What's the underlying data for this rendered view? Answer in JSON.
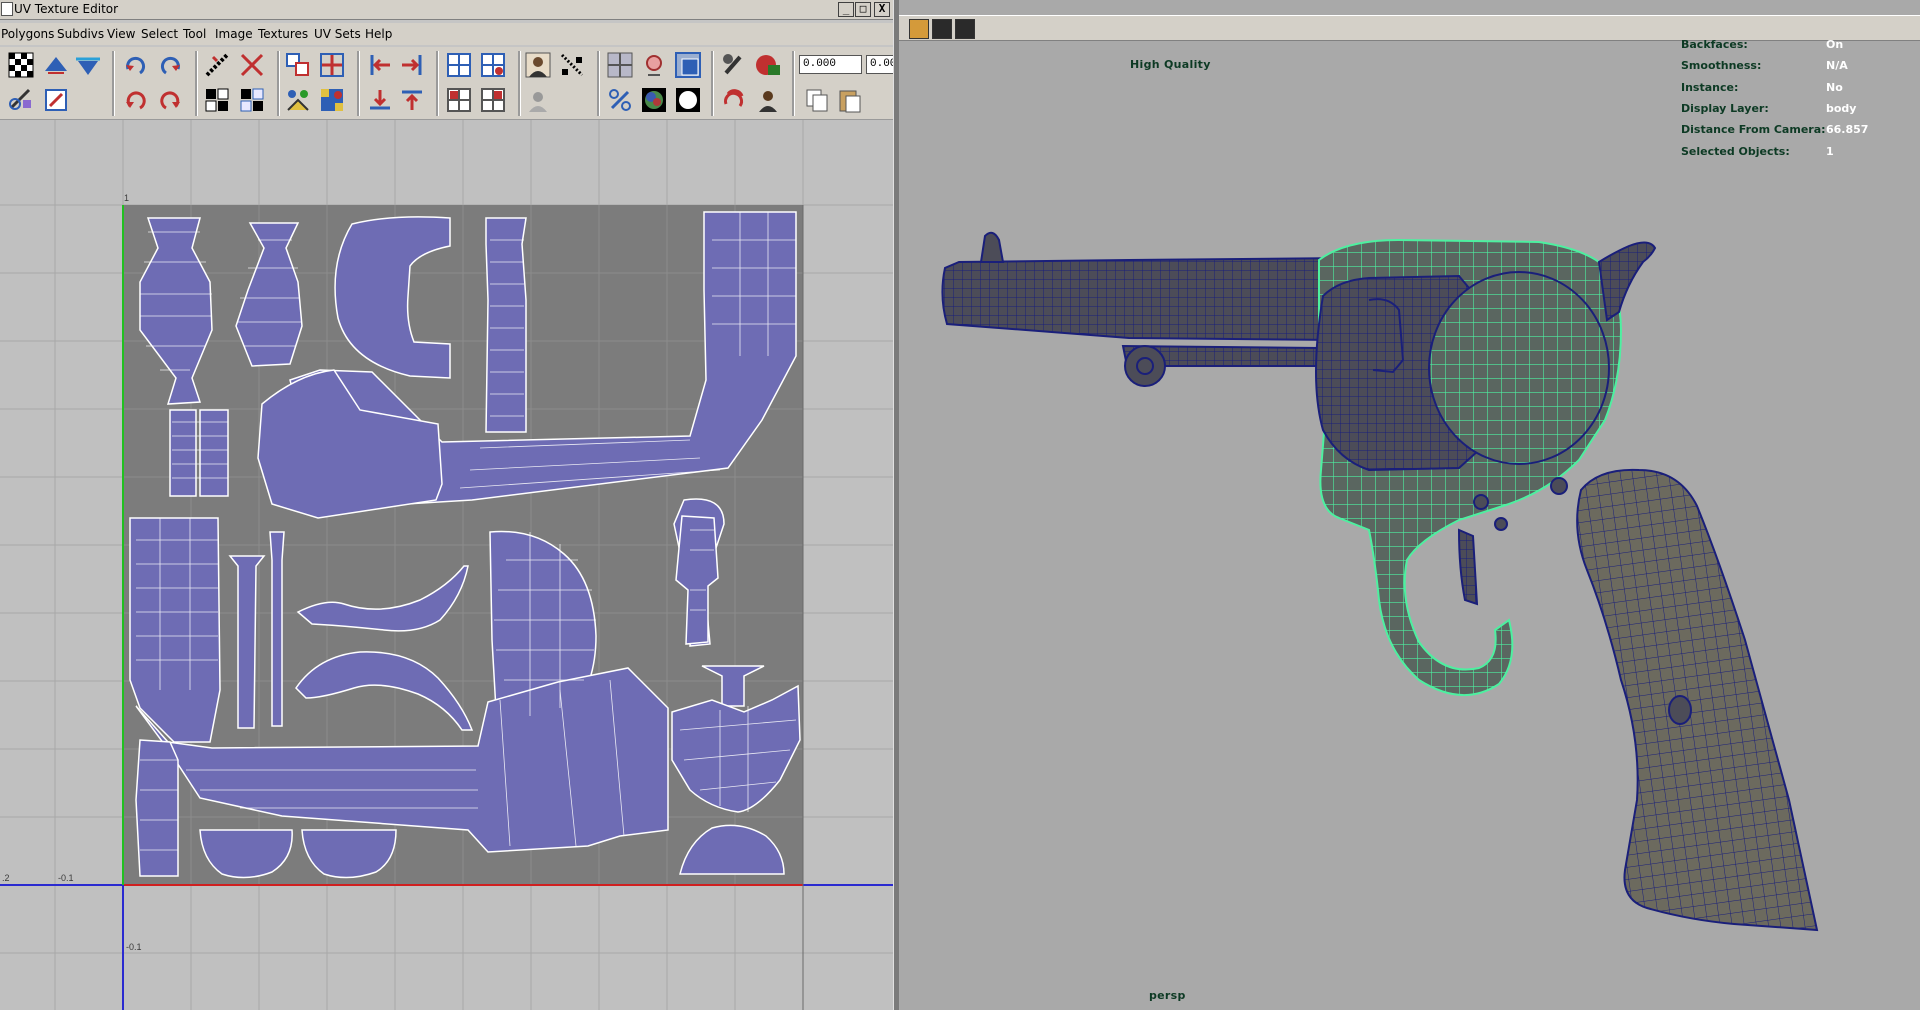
{
  "uv_editor": {
    "title": "UV Texture Editor",
    "window_buttons": {
      "minimize": "_",
      "maximize": "□",
      "close": "X"
    },
    "menus": [
      "Polygons",
      "Subdivs",
      "View",
      "Select",
      "Tool",
      "Image",
      "Textures",
      "UV Sets",
      "Help"
    ],
    "fields": {
      "u_value": "0.000",
      "v_value": "0.00"
    },
    "axis_labels": {
      "top_tick": "1",
      "left_neg_02": ".2",
      "left_neg_01": "-0.1",
      "below_neg_01": "-0.1"
    }
  },
  "viewport": {
    "quality_label": "High Quality",
    "camera_label": "persp",
    "hud": [
      {
        "label": "Backfaces:",
        "value": "On"
      },
      {
        "label": "Smoothness:",
        "value": "N/A"
      },
      {
        "label": "Instance:",
        "value": "No"
      },
      {
        "label": "Display Layer:",
        "value": "body"
      },
      {
        "label": "Distance From Camera:",
        "value": "66.857"
      },
      {
        "label": "Selected Objects:",
        "value": "1"
      }
    ]
  },
  "colors": {
    "uv_shell_fill": "#6e6cb4",
    "uv_line": "#ffffff",
    "uv_bg_tile": "#7c7c7c",
    "mesh_dark": "#4a4a55",
    "wire_blue": "#1a1f7a",
    "wire_green": "#4df0a0"
  }
}
